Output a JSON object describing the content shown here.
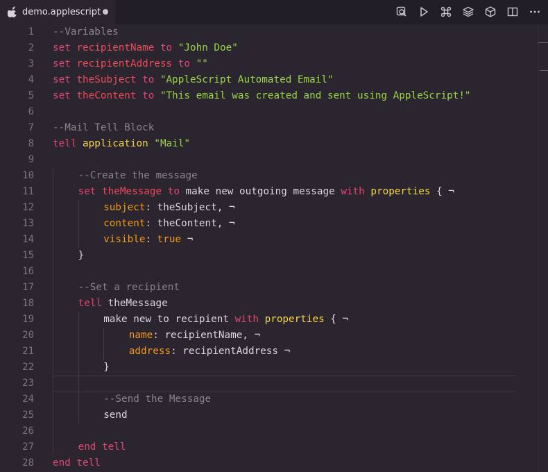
{
  "tab": {
    "title": "demo.applescript",
    "unsaved": true
  },
  "toolbar_icons": [
    "find-references-icon",
    "run-icon",
    "command-icon",
    "layers-icon",
    "cube-icon",
    "split-editor-icon",
    "more-actions-icon"
  ],
  "colors": {
    "background": "#2b2530",
    "keyword": "#e0476f",
    "variable": "#ec4b59",
    "string": "#98d646",
    "comment": "#8b838d",
    "property": "#f29b1c",
    "class": "#f6d64d",
    "text": "#ddd6df"
  },
  "editor": {
    "current_line": 23,
    "lines": [
      {
        "n": "1",
        "indent": 0,
        "tokens": [
          {
            "t": "--Variables",
            "c": "cmt"
          }
        ]
      },
      {
        "n": "2",
        "indent": 0,
        "tokens": [
          {
            "t": "set ",
            "c": "kw"
          },
          {
            "t": "recipientName",
            "c": "var"
          },
          {
            "t": " to ",
            "c": "kw"
          },
          {
            "t": "\"John Doe\"",
            "c": "str"
          }
        ]
      },
      {
        "n": "3",
        "indent": 0,
        "tokens": [
          {
            "t": "set ",
            "c": "kw"
          },
          {
            "t": "recipientAddress",
            "c": "var"
          },
          {
            "t": " to ",
            "c": "kw"
          },
          {
            "t": "\"\"",
            "c": "str"
          }
        ]
      },
      {
        "n": "4",
        "indent": 0,
        "tokens": [
          {
            "t": "set ",
            "c": "kw"
          },
          {
            "t": "theSubject",
            "c": "var"
          },
          {
            "t": " to ",
            "c": "kw"
          },
          {
            "t": "\"AppleScript Automated Email\"",
            "c": "str"
          }
        ]
      },
      {
        "n": "5",
        "indent": 0,
        "tokens": [
          {
            "t": "set ",
            "c": "kw"
          },
          {
            "t": "theContent",
            "c": "var"
          },
          {
            "t": " to ",
            "c": "kw"
          },
          {
            "t": "\"This email was created and sent using AppleScript!\"",
            "c": "str"
          }
        ]
      },
      {
        "n": "6",
        "indent": 0,
        "tokens": []
      },
      {
        "n": "7",
        "indent": 0,
        "tokens": [
          {
            "t": "--Mail Tell Block",
            "c": "cmt"
          }
        ]
      },
      {
        "n": "8",
        "indent": 0,
        "tokens": [
          {
            "t": "tell ",
            "c": "kw"
          },
          {
            "t": "application ",
            "c": "cls"
          },
          {
            "t": "\"Mail\"",
            "c": "str"
          }
        ]
      },
      {
        "n": "9",
        "indent": 0,
        "tokens": []
      },
      {
        "n": "10",
        "indent": 1,
        "tokens": [
          {
            "t": "--Create the message",
            "c": "cmt"
          }
        ]
      },
      {
        "n": "11",
        "indent": 1,
        "tokens": [
          {
            "t": "set ",
            "c": "kw"
          },
          {
            "t": "theMessage",
            "c": "var"
          },
          {
            "t": " to ",
            "c": "kw"
          },
          {
            "t": "make new outgoing message ",
            "c": "plain"
          },
          {
            "t": "with ",
            "c": "kw"
          },
          {
            "t": "properties",
            "c": "cls"
          },
          {
            "t": " { ¬",
            "c": "plain"
          }
        ]
      },
      {
        "n": "12",
        "indent": 2,
        "tokens": [
          {
            "t": "subject",
            "c": "prop"
          },
          {
            "t": ": theSubject, ¬",
            "c": "plain"
          }
        ]
      },
      {
        "n": "13",
        "indent": 2,
        "tokens": [
          {
            "t": "content",
            "c": "prop"
          },
          {
            "t": ": theContent, ¬",
            "c": "plain"
          }
        ]
      },
      {
        "n": "14",
        "indent": 2,
        "tokens": [
          {
            "t": "visible",
            "c": "prop"
          },
          {
            "t": ": ",
            "c": "plain"
          },
          {
            "t": "true",
            "c": "prop"
          },
          {
            "t": " ¬",
            "c": "plain"
          }
        ]
      },
      {
        "n": "15",
        "indent": 1,
        "tokens": [
          {
            "t": "}",
            "c": "plain"
          }
        ]
      },
      {
        "n": "16",
        "indent": 0,
        "tokens": []
      },
      {
        "n": "17",
        "indent": 1,
        "tokens": [
          {
            "t": "--Set a recipient",
            "c": "cmt"
          }
        ]
      },
      {
        "n": "18",
        "indent": 1,
        "tokens": [
          {
            "t": "tell ",
            "c": "kw"
          },
          {
            "t": "theMessage",
            "c": "plain"
          }
        ]
      },
      {
        "n": "19",
        "indent": 2,
        "tokens": [
          {
            "t": "make new to recipient ",
            "c": "plain"
          },
          {
            "t": "with ",
            "c": "kw"
          },
          {
            "t": "properties",
            "c": "cls"
          },
          {
            "t": " { ¬",
            "c": "plain"
          }
        ]
      },
      {
        "n": "20",
        "indent": 3,
        "tokens": [
          {
            "t": "name",
            "c": "prop"
          },
          {
            "t": ": recipientName, ¬",
            "c": "plain"
          }
        ]
      },
      {
        "n": "21",
        "indent": 3,
        "tokens": [
          {
            "t": "address",
            "c": "prop"
          },
          {
            "t": ": recipientAddress ¬",
            "c": "plain"
          }
        ]
      },
      {
        "n": "22",
        "indent": 2,
        "tokens": [
          {
            "t": "}",
            "c": "plain"
          }
        ]
      },
      {
        "n": "23",
        "indent": 0,
        "tokens": []
      },
      {
        "n": "24",
        "indent": 2,
        "tokens": [
          {
            "t": "--Send the Message",
            "c": "cmt"
          }
        ]
      },
      {
        "n": "25",
        "indent": 2,
        "tokens": [
          {
            "t": "send",
            "c": "plain"
          }
        ]
      },
      {
        "n": "26",
        "indent": 0,
        "tokens": []
      },
      {
        "n": "27",
        "indent": 1,
        "tokens": [
          {
            "t": "end tell",
            "c": "kw"
          }
        ]
      },
      {
        "n": "28",
        "indent": 0,
        "tokens": [
          {
            "t": "end tell",
            "c": "kw"
          }
        ]
      }
    ]
  }
}
